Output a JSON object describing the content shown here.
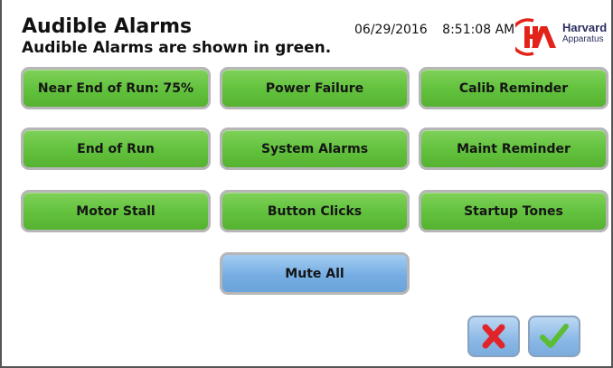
{
  "header": {
    "title": "Audible Alarms",
    "subtitle": "Audible Alarms are shown in green.",
    "date": "06/29/2016",
    "time": "8:51:08 AM"
  },
  "logo": {
    "mark": "HA",
    "line1": "Harvard",
    "line2": "Apparatus"
  },
  "alarms": [
    {
      "label": "Near End of Run: 75%",
      "audible": true
    },
    {
      "label": "Power Failure",
      "audible": true
    },
    {
      "label": "Calib Reminder",
      "audible": true
    },
    {
      "label": "End of Run",
      "audible": true
    },
    {
      "label": "System Alarms",
      "audible": true
    },
    {
      "label": "Maint Reminder",
      "audible": true
    },
    {
      "label": "Motor Stall",
      "audible": true
    },
    {
      "label": "Button Clicks",
      "audible": true
    },
    {
      "label": "Startup Tones",
      "audible": true
    }
  ],
  "mute_all": {
    "label": "Mute All"
  },
  "footer": {
    "cancel_icon": "x-icon",
    "confirm_icon": "check-icon"
  },
  "colors": {
    "audible_green": "#61c13c",
    "mute_blue": "#76aee3",
    "cancel_red": "#e0242a",
    "confirm_green": "#5bbd34",
    "brand_red": "#e2231a",
    "brand_navy": "#2b2e5e"
  }
}
